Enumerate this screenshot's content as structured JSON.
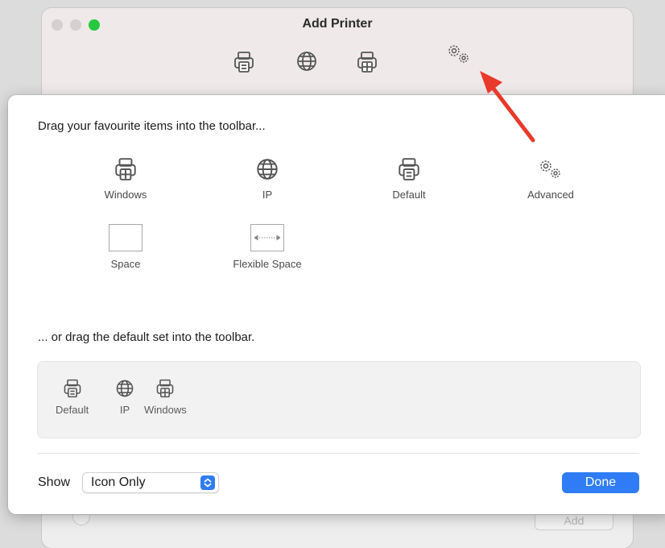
{
  "window": {
    "title": "Add Printer",
    "bottom_add_label": "Add"
  },
  "sheet": {
    "heading_items": "Drag your favourite items into the toolbar...",
    "items": [
      {
        "label": "Windows",
        "icon": "windows-printer-icon"
      },
      {
        "label": "IP",
        "icon": "globe-icon"
      },
      {
        "label": "Default",
        "icon": "printer-icon"
      },
      {
        "label": "Advanced",
        "icon": "gears-icon"
      },
      {
        "label": "Space",
        "icon": "space-icon"
      },
      {
        "label": "Flexible Space",
        "icon": "flexible-space-icon"
      }
    ],
    "heading_default": "... or drag the default set into the toolbar.",
    "default_set": [
      {
        "label": "Default",
        "icon": "printer-icon"
      },
      {
        "label": "IP",
        "icon": "globe-icon"
      },
      {
        "label": "Windows",
        "icon": "windows-printer-icon"
      }
    ],
    "show_label": "Show",
    "show_value": "Icon Only",
    "done_label": "Done"
  },
  "colors": {
    "accent": "#2f7cf6",
    "arrow": "#e8392a",
    "traffic_green": "#27c83f"
  }
}
